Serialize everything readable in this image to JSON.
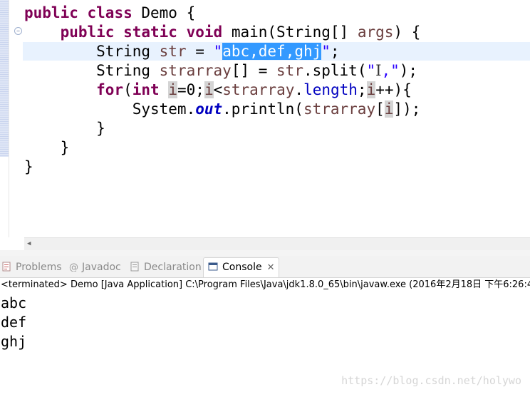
{
  "editor": {
    "lines": [
      [
        {
          "t": "public",
          "c": "kw"
        },
        {
          "t": " "
        },
        {
          "t": "class",
          "c": "kw"
        },
        {
          "t": " Demo {"
        }
      ],
      [
        {
          "t": "    "
        },
        {
          "t": "public",
          "c": "kw"
        },
        {
          "t": " "
        },
        {
          "t": "static",
          "c": "kw"
        },
        {
          "t": " "
        },
        {
          "t": "void",
          "c": "kw"
        },
        {
          "t": " main(String[] "
        },
        {
          "t": "args",
          "c": "var"
        },
        {
          "t": ") {"
        }
      ],
      [
        {
          "t": "        String "
        },
        {
          "t": "str",
          "c": "var"
        },
        {
          "t": " = "
        },
        {
          "t": "\"",
          "c": "str"
        },
        {
          "t": "abc,def,ghj",
          "c": "sel"
        },
        {
          "t": "\"",
          "c": "str"
        },
        {
          "t": ";"
        }
      ],
      [
        {
          "t": "        String "
        },
        {
          "t": "strarray",
          "c": "var"
        },
        {
          "t": "[] = "
        },
        {
          "t": "str",
          "c": "var"
        },
        {
          "t": ".split("
        },
        {
          "t": "\"",
          "c": "str"
        },
        {
          "t": "I",
          "c": "caret"
        },
        {
          "t": ",\"",
          "c": "str"
        },
        {
          "t": ");"
        }
      ],
      [
        {
          "t": "        "
        },
        {
          "t": "for",
          "c": "kw"
        },
        {
          "t": "("
        },
        {
          "t": "int",
          "c": "kw"
        },
        {
          "t": " "
        },
        {
          "t": "i",
          "c": "var mark"
        },
        {
          "t": "=0;"
        },
        {
          "t": "i",
          "c": "var mark"
        },
        {
          "t": "<"
        },
        {
          "t": "strarray",
          "c": "var"
        },
        {
          "t": "."
        },
        {
          "t": "length",
          "c": "fld"
        },
        {
          "t": ";"
        },
        {
          "t": "i",
          "c": "var mark"
        },
        {
          "t": "++){"
        }
      ],
      [
        {
          "t": "            System."
        },
        {
          "t": "out",
          "c": "sf"
        },
        {
          "t": ".println("
        },
        {
          "t": "strarray",
          "c": "var"
        },
        {
          "t": "["
        },
        {
          "t": "i",
          "c": "var mark"
        },
        {
          "t": "]);"
        }
      ],
      [
        {
          "t": "        }"
        }
      ],
      [
        {
          "t": "    }"
        }
      ],
      [
        {
          "t": "}"
        }
      ]
    ]
  },
  "tabs": [
    {
      "label": "Problems",
      "icon": "problems-icon"
    },
    {
      "label": "Javadoc",
      "icon": "javadoc-icon"
    },
    {
      "label": "Declaration",
      "icon": "declaration-icon"
    },
    {
      "label": "Console",
      "icon": "console-icon",
      "active": true
    }
  ],
  "console": {
    "status": "<terminated> Demo [Java Application] C:\\Program Files\\Java\\jdk1.8.0_65\\bin\\javaw.exe (2016年2月18日 下午6:26:4",
    "output": [
      "abc",
      "def",
      "ghj"
    ]
  },
  "watermark": "https://blog.csdn.net/holywo",
  "colors": {
    "keyword": "#7f0055",
    "string": "#2a00ff",
    "selection": "#3399ff",
    "variable": "#6a3e3e"
  }
}
